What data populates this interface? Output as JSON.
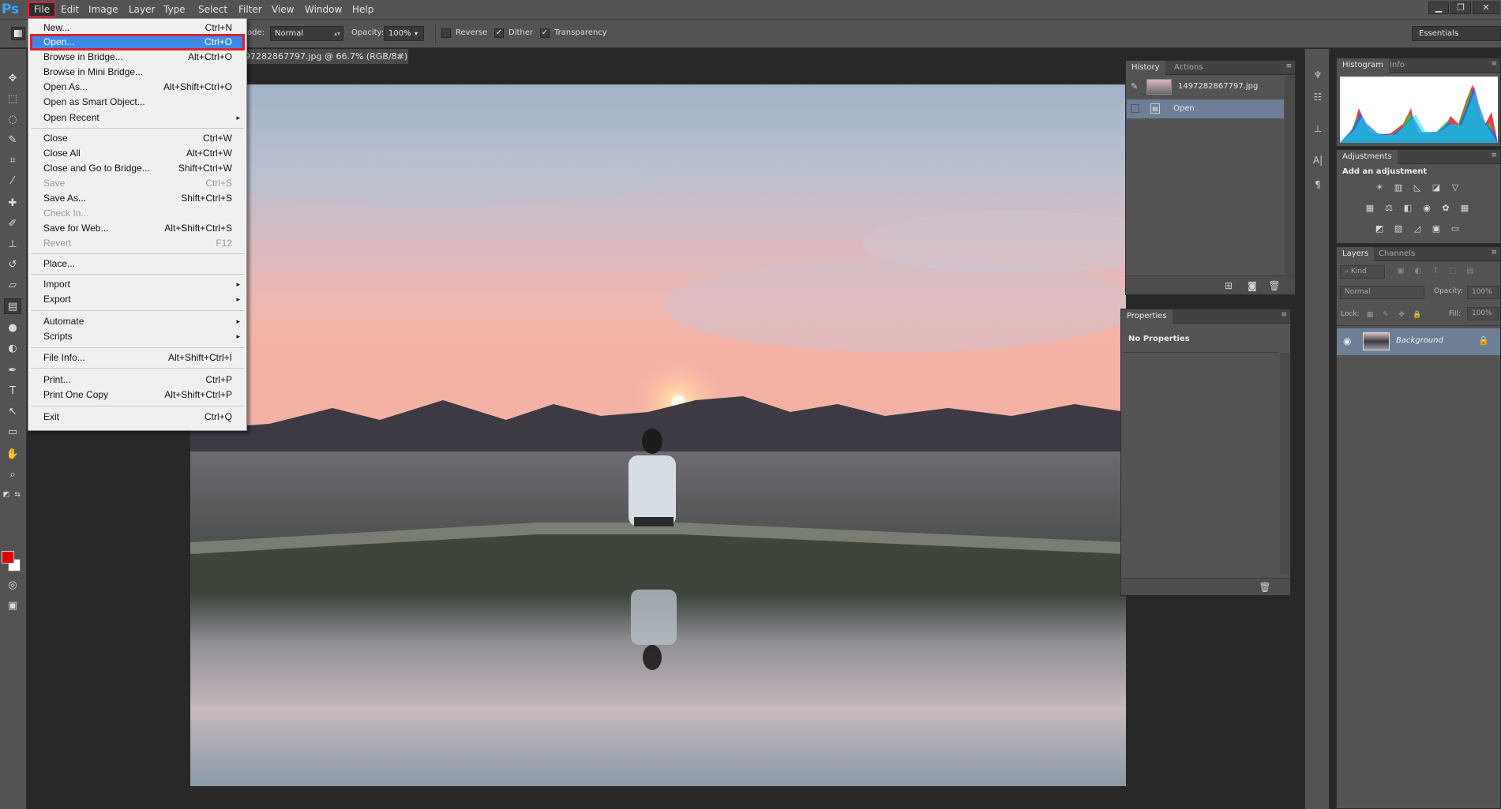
{
  "menubar": {
    "logo": "Ps",
    "items": [
      "File",
      "Edit",
      "Image",
      "Layer",
      "Type",
      "Select",
      "Filter",
      "View",
      "Window",
      "Help"
    ]
  },
  "window_controls": [
    "minimize-icon",
    "restore-icon",
    "close-icon"
  ],
  "options": {
    "mode_label": "ode:",
    "mode_value": "Normal",
    "opacity_label": "Opacity:",
    "opacity_value": "100%",
    "reverse_label": "Reverse",
    "dither_label": "Dither",
    "transparency_label": "Transparency",
    "reverse_checked": false,
    "dither_checked": true,
    "transparency_checked": true,
    "workspace": "Essentials"
  },
  "document": {
    "tab_title": "1497282867797.jpg @ 66.7% (RGB/8#)",
    "tab_visible_title": "97282867797.jpg @ 66.7% (RGB/8#)",
    "close": "×"
  },
  "file_menu": {
    "items": [
      {
        "label": "New...",
        "shortcut": "Ctrl+N"
      },
      {
        "label": "Open...",
        "shortcut": "Ctrl+O"
      },
      {
        "label": "Browse in Bridge...",
        "shortcut": "Alt+Ctrl+O"
      },
      {
        "label": "Browse in Mini Bridge...",
        "shortcut": ""
      },
      {
        "label": "Open As...",
        "shortcut": "Alt+Shift+Ctrl+O"
      },
      {
        "label": "Open as Smart Object...",
        "shortcut": ""
      },
      {
        "label": "Open Recent",
        "shortcut": ""
      },
      {
        "label": "Close",
        "shortcut": "Ctrl+W"
      },
      {
        "label": "Close All",
        "shortcut": "Alt+Ctrl+W"
      },
      {
        "label": "Close and Go to Bridge...",
        "shortcut": "Shift+Ctrl+W"
      },
      {
        "label": "Save",
        "shortcut": "Ctrl+S"
      },
      {
        "label": "Save As...",
        "shortcut": "Shift+Ctrl+S"
      },
      {
        "label": "Check In...",
        "shortcut": ""
      },
      {
        "label": "Save for Web...",
        "shortcut": "Alt+Shift+Ctrl+S"
      },
      {
        "label": "Revert",
        "shortcut": "F12"
      },
      {
        "label": "Place...",
        "shortcut": ""
      },
      {
        "label": "Import",
        "shortcut": ""
      },
      {
        "label": "Export",
        "shortcut": ""
      },
      {
        "label": "Automate",
        "shortcut": ""
      },
      {
        "label": "Scripts",
        "shortcut": ""
      },
      {
        "label": "File Info...",
        "shortcut": "Alt+Shift+Ctrl+I"
      },
      {
        "label": "Print...",
        "shortcut": "Ctrl+P"
      },
      {
        "label": "Print One Copy",
        "shortcut": "Alt+Shift+Ctrl+P"
      },
      {
        "label": "Exit",
        "shortcut": "Ctrl+Q"
      }
    ],
    "submenu_arrow": "▸"
  },
  "history_panel": {
    "tabs": [
      "History",
      "Actions"
    ],
    "snapshot_name": "1497282867797.jpg",
    "steps": [
      "Open"
    ]
  },
  "properties_panel": {
    "tab": "Properties",
    "message": "No Properties"
  },
  "histogram_panel": {
    "tabs": [
      "Histogram",
      "Info"
    ],
    "warning": "⚠"
  },
  "adjustments_panel": {
    "tab": "Adjustments",
    "heading": "Add an adjustment"
  },
  "layers_panel": {
    "tabs": [
      "Layers",
      "Channels"
    ],
    "filter_value": "Kind",
    "blend_value": "Normal",
    "opacity_label": "Opacity:",
    "opacity_value": "100%",
    "lock_label": "Lock:",
    "fill_label": "Fill:",
    "fill_value": "100%",
    "layer_name": "Background"
  },
  "colors": {
    "foreground": "#e30000",
    "background": "#ffffff",
    "highlight": "#3c8ae6",
    "annotation": "#e0202f"
  }
}
